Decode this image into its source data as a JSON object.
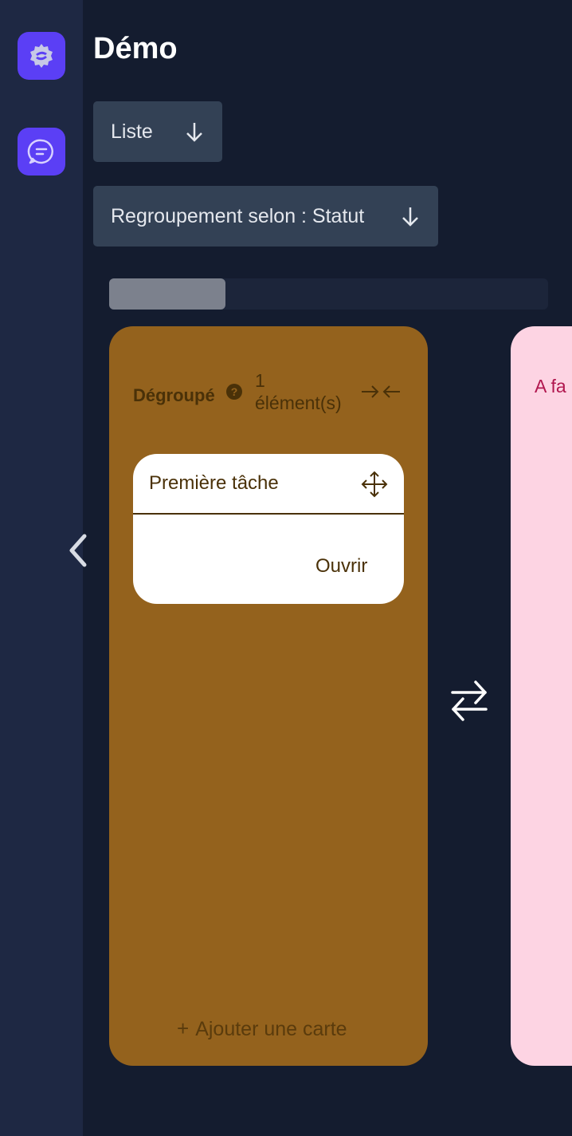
{
  "header": {
    "title": "Démo"
  },
  "toolbar": {
    "view_label": "Liste",
    "grouping_label": "Regroupement selon : Statut"
  },
  "rail": {
    "icons": [
      "settings-logo-icon",
      "chat-icon"
    ]
  },
  "columns": [
    {
      "title": "Dégroupé",
      "count": "1",
      "count_unit": "élément(s)",
      "cards": [
        {
          "title": "Première tâche",
          "action": "Ouvrir"
        }
      ],
      "add_label": "Ajouter une carte",
      "color": "#94621d"
    },
    {
      "title": "A fa",
      "color": "#fdd4e3"
    }
  ],
  "colors": {
    "background": "#141c2f",
    "rail": "#1e2843",
    "accent": "#5b3ff5",
    "dropdown": "#334155"
  }
}
